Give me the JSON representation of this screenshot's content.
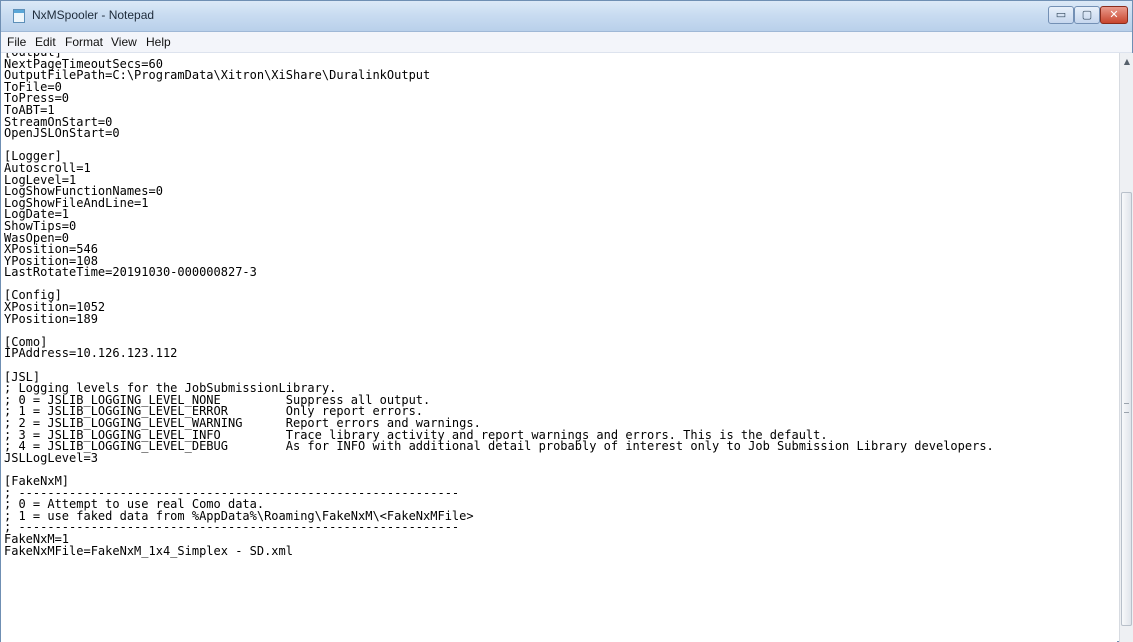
{
  "window": {
    "title": "NxMSpooler - Notepad",
    "controls": [
      "▭",
      "▢",
      "✕"
    ]
  },
  "menu": {
    "file": "File",
    "edit": "Edit",
    "format": "Format",
    "view": "View",
    "help": "Help"
  },
  "document": {
    "text": "[Output]\nNextPageTimeoutSecs=60\nOutputFilePath=C:\\ProgramData\\Xitron\\XiShare\\DuralinkOutput\nToFile=0\nToPress=0\nToABT=1\nStreamOnStart=0\nOpenJSLOnStart=0\n\n[Logger]\nAutoscroll=1\nLogLevel=1\nLogShowFunctionNames=0\nLogShowFileAndLine=1\nLogDate=1\nShowTips=0\nWasOpen=0\nXPosition=546\nYPosition=108\nLastRotateTime=20191030-000000827-3\n\n[Config]\nXPosition=1052\nYPosition=189\n\n[Como]\nIPAddress=10.126.123.112\n\n[JSL]\n; Logging levels for the JobSubmissionLibrary.\n; 0 = JSLIB_LOGGING_LEVEL_NONE         Suppress all output.\n; 1 = JSLIB_LOGGING_LEVEL_ERROR        Only report errors.\n; 2 = JSLIB_LOGGING_LEVEL_WARNING      Report errors and warnings.\n; 3 = JSLIB_LOGGING_LEVEL_INFO         Trace library activity and report warnings and errors. This is the default.\n; 4 = JSLIB_LOGGING_LEVEL_DEBUG        As for INFO with additional detail probably of interest only to Job Submission Library developers.\nJSLLogLevel=3\n\n[FakeNxM]\n; -------------------------------------------------------------\n; 0 = Attempt to use real Como data.\n; 1 = use faked data from %AppData%\\Roaming\\FakeNxM\\<FakeNxMFile>\n; -------------------------------------------------------------\nFakeNxM=1\nFakeNxMFile=FakeNxM_1x4_Simplex - SD.xml"
  }
}
